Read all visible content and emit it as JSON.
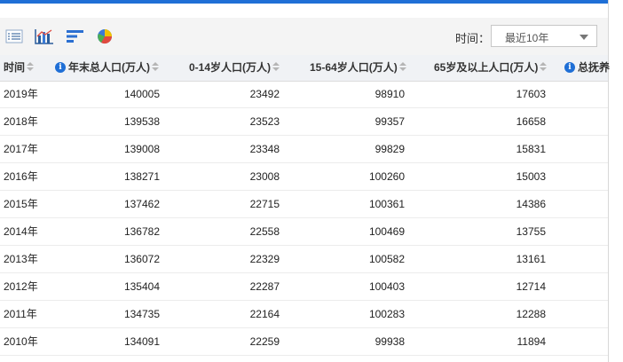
{
  "toolbar": {
    "tools": [
      {
        "icon": "table-view-icon"
      },
      {
        "icon": "bar-chart-icon"
      },
      {
        "icon": "horizontal-bar-chart-icon"
      },
      {
        "icon": "pie-chart-icon"
      }
    ],
    "time_label": "时间：",
    "time_select_value": "最近10年"
  },
  "table": {
    "columns": [
      "时间",
      "年末总人口(万人)",
      "0-14岁人口(万人)",
      "15-64岁人口(万人)",
      "65岁及以上人口(万人)",
      "总抚养"
    ],
    "rows": [
      [
        "2019年",
        "140005",
        "23492",
        "98910",
        "17603"
      ],
      [
        "2018年",
        "139538",
        "23523",
        "99357",
        "16658"
      ],
      [
        "2017年",
        "139008",
        "23348",
        "99829",
        "15831"
      ],
      [
        "2016年",
        "138271",
        "23008",
        "100260",
        "15003"
      ],
      [
        "2015年",
        "137462",
        "22715",
        "100361",
        "14386"
      ],
      [
        "2014年",
        "136782",
        "22558",
        "100469",
        "13755"
      ],
      [
        "2013年",
        "136072",
        "22329",
        "100582",
        "13161"
      ],
      [
        "2012年",
        "135404",
        "22287",
        "100403",
        "12714"
      ],
      [
        "2011年",
        "134735",
        "22164",
        "100283",
        "12288"
      ],
      [
        "2010年",
        "134091",
        "22259",
        "99938",
        "11894"
      ]
    ]
  },
  "colors": {
    "accent": "#1f6fd6",
    "header_bg": "#f0f2f5",
    "toolbar_bg": "#f4f4f4"
  }
}
